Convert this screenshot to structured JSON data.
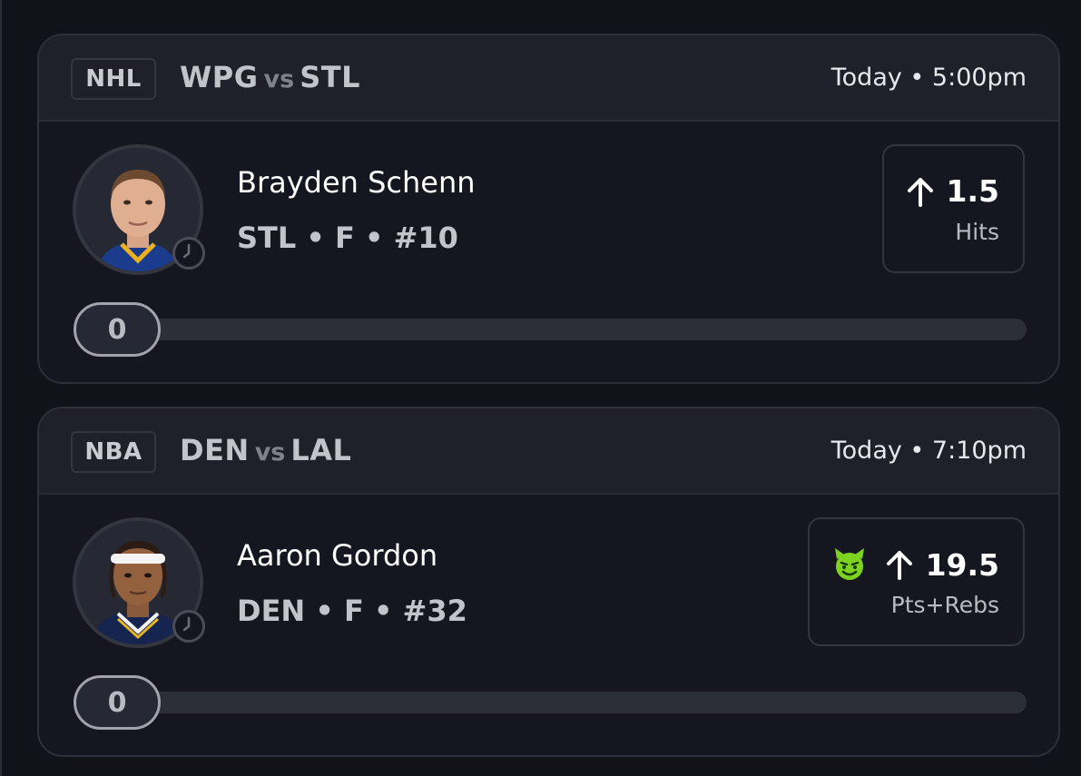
{
  "picks": [
    {
      "league": "NHL",
      "home_team": "WPG",
      "vs_label": "vs",
      "away_team": "STL",
      "game_time": "Today • 5:00pm",
      "player": {
        "name": "Brayden Schenn",
        "meta": "STL • F • #10",
        "avatar_icon": "player-headshot",
        "status_icon": "clock-icon"
      },
      "projection": {
        "direction_icon": "arrow-up-icon",
        "value": "1.5",
        "stat": "Hits"
      },
      "progress": {
        "current": "0",
        "fraction": 0
      }
    },
    {
      "league": "NBA",
      "home_team": "DEN",
      "vs_label": "vs",
      "away_team": "LAL",
      "game_time": "Today • 7:10pm",
      "player": {
        "name": "Aaron Gordon",
        "meta": "DEN • F • #32",
        "avatar_icon": "player-headshot",
        "status_icon": "clock-icon"
      },
      "projection": {
        "modifier_icon": "devil-icon",
        "direction_icon": "arrow-up-icon",
        "value": "19.5",
        "stat": "Pts+Rebs"
      },
      "progress": {
        "current": "0",
        "fraction": 0
      }
    }
  ],
  "colors": {
    "background": "#11121a",
    "card": "#151620",
    "header": "#1f2029",
    "devil_green": "#7ed321"
  }
}
